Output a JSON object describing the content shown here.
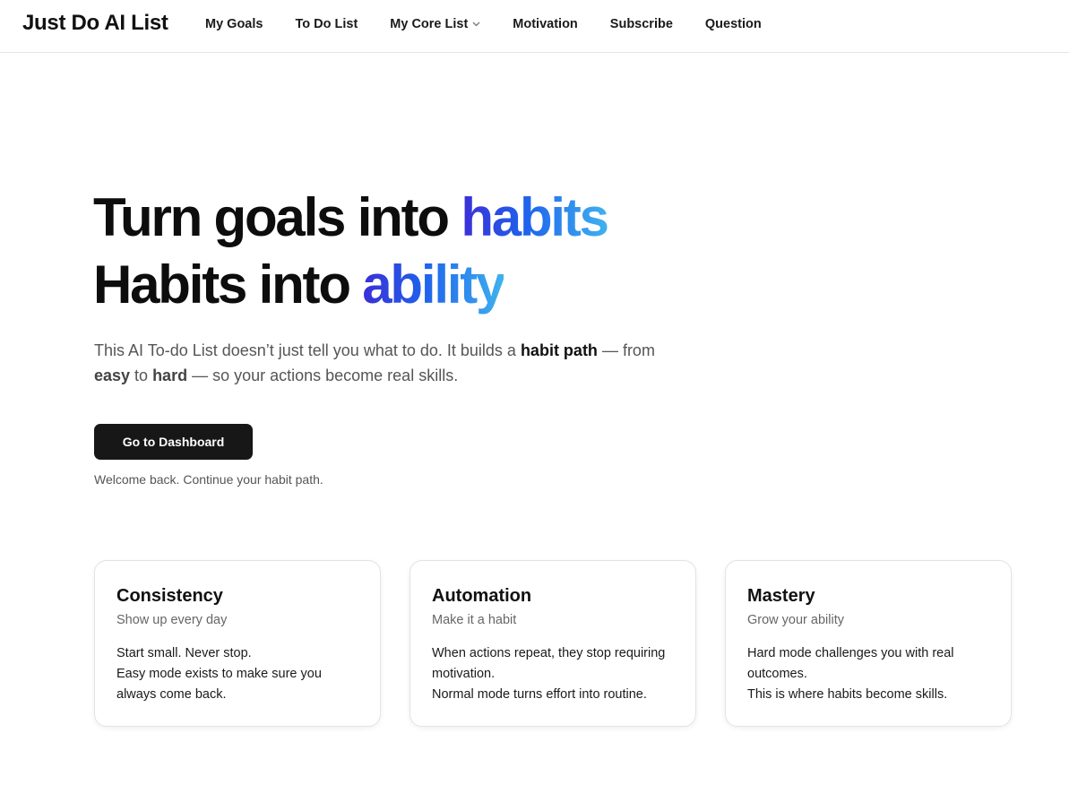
{
  "header": {
    "brand": "Just Do AI List",
    "nav": [
      {
        "label": "My Goals"
      },
      {
        "label": "To Do List"
      },
      {
        "label": "My Core List",
        "dropdown": true
      },
      {
        "label": "Motivation"
      },
      {
        "label": "Subscribe"
      },
      {
        "label": "Question"
      }
    ]
  },
  "hero": {
    "line1_plain": "Turn goals into ",
    "line1_accent": "habits",
    "line2_plain": "Habits into ",
    "line2_accent": "ability",
    "desc": {
      "p1": "This AI To-do List doesn’t just tell you what to do. It builds a ",
      "b1": "habit path",
      "p2": " — from ",
      "b2": "easy",
      "p3": " to ",
      "b3": "hard",
      "p4": " — so your actions become real skills."
    },
    "cta_label": "Go to Dashboard",
    "welcome": "Welcome back. Continue your habit path."
  },
  "cards": [
    {
      "title": "Consistency",
      "subtitle": "Show up every day",
      "lines": [
        "Start small. Never stop.",
        "Easy mode exists to make sure you always come back."
      ]
    },
    {
      "title": "Automation",
      "subtitle": "Make it a habit",
      "lines": [
        "When actions repeat, they stop requiring motivation.",
        "Normal mode turns effort into routine."
      ]
    },
    {
      "title": "Mastery",
      "subtitle": "Grow your ability",
      "lines": [
        "Hard mode challenges you with real outcomes.",
        "This is where habits become skills."
      ]
    }
  ],
  "colors": {
    "accent_gradient": [
      "#3b2fd6",
      "#1f63ec",
      "#3fb2ee"
    ],
    "button_bg": "#171717"
  },
  "icons": {
    "dropdown": "chevron-down-icon"
  }
}
